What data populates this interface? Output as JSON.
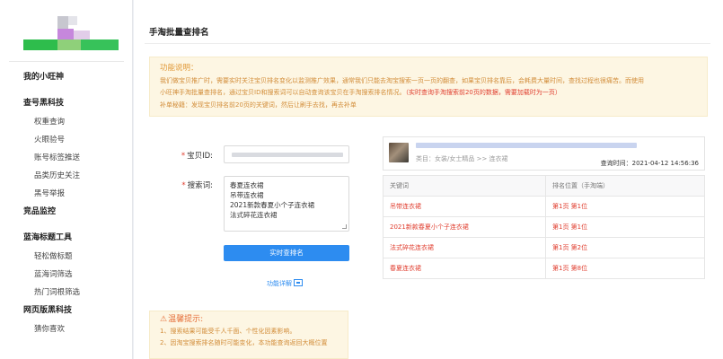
{
  "sidebar": {
    "groups": [
      {
        "label": "我的小旺神",
        "items": []
      },
      {
        "label": "查号黑科技",
        "items": [
          "权重查询",
          "火眼验号",
          "账号标签推送",
          "品类历史关注",
          "黑号举报"
        ]
      },
      {
        "label": "竞品监控",
        "items": []
      },
      {
        "label": "蓝海标题工具",
        "items": [
          "轻松做标题",
          "蓝海词筛选",
          "热门词根筛选"
        ]
      },
      {
        "label": "网页版黑科技",
        "items": [
          "猜你喜欢"
        ]
      }
    ]
  },
  "page": {
    "title": "手淘批量查排名"
  },
  "notice": {
    "heading": "功能说明：",
    "line1": "我们做宝贝推广时，需要实时关注宝贝排名变化以监测推广效果，通常我们只能去淘宝搜索一页一页的翻查，如果宝贝排名靠后，会耗费大量时间，查找过程也很痛苦。而使用",
    "line2_normal": "小旺神手淘批量查排名，通过宝贝ID和搜索词可以自动查询该宝贝在手淘搜索排名情况。",
    "line2_red": "（实时查询手淘搜索前20页的数据，需要加载时为一页）",
    "line3": "补单秘籍：发现宝贝排名前20页的关键词，然后让刷手去找，再去补单"
  },
  "form": {
    "id_label": "宝贝ID:",
    "keywords_label": "搜索词:",
    "keywords": [
      "春夏连衣裙",
      "吊带连衣裙",
      "2021新款春夏小个子连衣裙",
      "法式碎花连衣裙"
    ],
    "query_button": "实时查排名",
    "detail_link": "功能详解"
  },
  "tips": {
    "heading": "温馨提示:",
    "items": [
      "1、搜索结果可能受千人千面、个性化因素影响。",
      "2、因淘宝搜索排名随时可能变化，本功能查询返回大概位置"
    ]
  },
  "product": {
    "category": "类目：女装/女士精品 >> 连衣裙",
    "query_time": "查询时间：2021-04-12 14:56:36"
  },
  "table": {
    "headers": [
      "关键词",
      "排名位置（手淘端）"
    ],
    "rows": [
      {
        "keyword": "吊带连衣裙",
        "rank": "第1页 第1位"
      },
      {
        "keyword": "2021新款春夏小个子连衣裙",
        "rank": "第1页 第1位"
      },
      {
        "keyword": "法式碎花连衣裙",
        "rank": "第1页 第2位"
      },
      {
        "keyword": "春夏连衣裙",
        "rank": "第1页 第8位"
      }
    ]
  },
  "colors": {
    "accent": "#2d8cf0",
    "warning_bg": "#fdf6e3",
    "warning_text": "#d28d3a",
    "alert_red": "#e03d2e"
  }
}
